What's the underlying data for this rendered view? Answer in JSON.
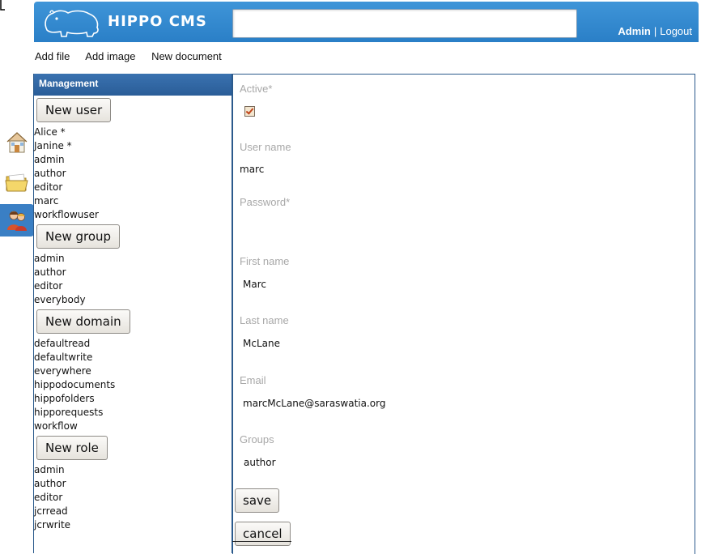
{
  "header": {
    "brand": "HIPPO CMS",
    "search_value": "",
    "user": "Admin",
    "separator": "|",
    "logout": "Logout"
  },
  "toolbar": {
    "add_file": "Add file",
    "add_image": "Add image",
    "new_document": "New document"
  },
  "rail": {
    "items": [
      {
        "icon": "home-icon"
      },
      {
        "icon": "folder-icon"
      },
      {
        "icon": "users-icon",
        "active": true
      }
    ]
  },
  "management": {
    "title": "Management",
    "new_user": "New user",
    "users": [
      "Alice *",
      "Janine *",
      "admin",
      "author",
      "editor",
      "marc",
      "workflowuser"
    ],
    "new_group": "New group",
    "groups": [
      "admin",
      "author",
      "editor",
      "everybody"
    ],
    "new_domain": "New domain",
    "domains": [
      "defaultread",
      "defaultwrite",
      "everywhere",
      "hippodocuments",
      "hippofolders",
      "hipporequests",
      "workflow"
    ],
    "new_role": "New role",
    "roles": [
      "admin",
      "author",
      "editor",
      "jcrread",
      "jcrwrite"
    ]
  },
  "form": {
    "active_label": "Active*",
    "active_checked": true,
    "username_label": "User name",
    "username_value": "marc",
    "password_label": "Password*",
    "firstname_label": "First name",
    "firstname_value": "Marc",
    "lastname_label": "Last name",
    "lastname_value": "McLane",
    "email_label": "Email",
    "email_value": "marcMcLane@saraswatia.org",
    "groups_label": "Groups",
    "groups_value": "author",
    "save": "save",
    "cancel": "cancel"
  },
  "colors": {
    "header_blue": "#2a7fc7",
    "panel_header": "#2a5d98",
    "checkbox_check": "#c0441b"
  }
}
